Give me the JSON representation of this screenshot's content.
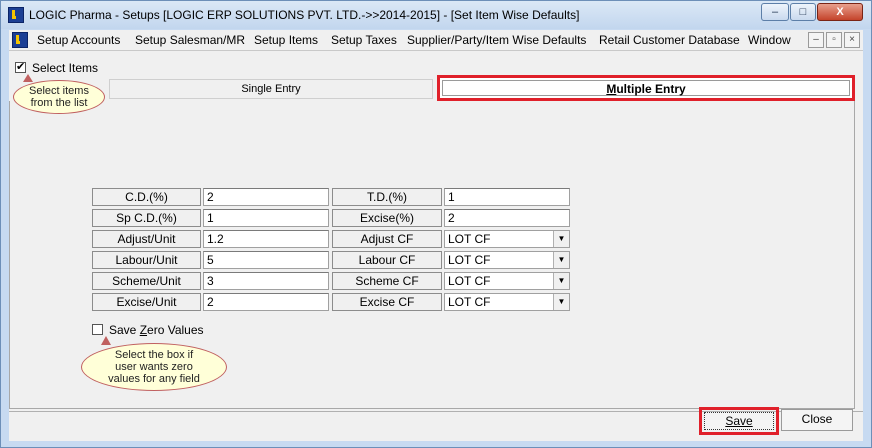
{
  "window": {
    "title": "LOGIC Pharma - Setups  [LOGIC ERP SOLUTIONS PVT. LTD.->>2014-2015] - [Set Item Wise Defaults]",
    "minimize": "–",
    "maximize": "□",
    "close": "X"
  },
  "menu": {
    "items": [
      "Setup Accounts",
      "Setup Salesman/MR",
      "Setup Items",
      "Setup Taxes",
      "Supplier/Party/Item Wise Defaults",
      "Retail Customer Database",
      "Window"
    ],
    "mdi_min": "–",
    "mdi_restore": "▫",
    "mdi_close": "×"
  },
  "select_items": {
    "label": "Select Items",
    "checked": true
  },
  "callout_select": {
    "line1": "Select items",
    "line2": "from the list"
  },
  "tabs": {
    "single": "Single Entry",
    "multiple": "Multiple Entry"
  },
  "form": {
    "rows": [
      {
        "left_label": "C.D.(%)",
        "left_value": "2",
        "right_label": "T.D.(%)",
        "right_value": "1",
        "right_type": "input"
      },
      {
        "left_label": "Sp C.D.(%)",
        "left_value": "1",
        "right_label": "Excise(%)",
        "right_value": "2",
        "right_type": "input"
      },
      {
        "left_label": "Adjust/Unit",
        "left_value": "1.2",
        "right_label": "Adjust CF",
        "right_value": "LOT CF",
        "right_type": "select"
      },
      {
        "left_label": "Labour/Unit",
        "left_value": "5",
        "right_label": "Labour CF",
        "right_value": "LOT CF",
        "right_type": "select"
      },
      {
        "left_label": "Scheme/Unit",
        "left_value": "3",
        "right_label": "Scheme CF",
        "right_value": "LOT CF",
        "right_type": "select"
      },
      {
        "left_label": "Excise/Unit",
        "left_value": "2",
        "right_label": "Excise CF",
        "right_value": "LOT CF",
        "right_type": "select"
      }
    ]
  },
  "save_zero": {
    "label": "Save Zero Values",
    "checked": false
  },
  "callout_zero": {
    "line1": "Select the box if",
    "line2": "user wants zero",
    "line3": "values for any field"
  },
  "buttons": {
    "save": "Save",
    "close": "Close"
  },
  "colors": {
    "highlight": "#e0202a",
    "callout_bg": "#ffffd8"
  }
}
